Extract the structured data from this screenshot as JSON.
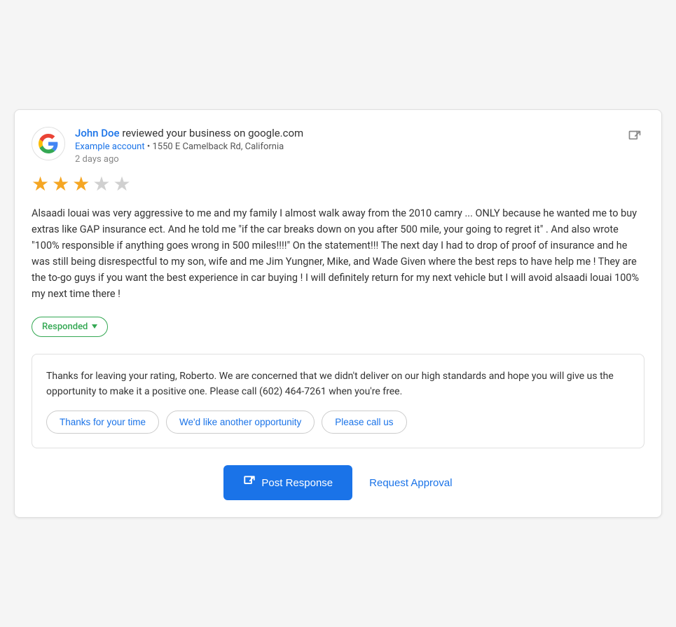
{
  "card": {
    "google_logo_alt": "Google logo",
    "reviewer": {
      "name": "John Doe",
      "review_title": "reviewed your business on google.com"
    },
    "account": {
      "name": "Example account",
      "address": "1550 E Camelback Rd, California"
    },
    "date": "2 days ago",
    "stars": {
      "filled": 3,
      "empty": 2,
      "total": 5
    },
    "review_text": "Alsaadi louai was very aggressive to me and my family I almost walk away from the 2010 camry ... ONLY because he wanted me to buy extras like GAP insurance ect. And he told me \"if the car breaks down on you after 500 mile, your going to regret it\" . And also wrote \"100% responsible if anything goes wrong in 500 miles!!!!\" On the statement!!! The next day I had to drop of proof of insurance and he was still being disrespectful to my son, wife and me Jim Yungner, Mike, and Wade Given where the best reps to have help me ! They are the to-go guys if you want the best experience in car buying ! I will definitely return for my next vehicle but I will avoid alsaadi louai 100% my next time there !",
    "responded_badge": "Responded",
    "response_box": {
      "text": "Thanks for leaving your rating, Roberto. We are concerned that we didn't deliver on our high standards and hope you will give us the opportunity to make it a positive one. Please call (602) 464-7261 when you're free.",
      "suggestions": [
        "Thanks for your time",
        "We'd like another opportunity",
        "Please call us"
      ]
    },
    "actions": {
      "post_response_label": "Post Response",
      "request_approval_label": "Request Approval"
    }
  }
}
